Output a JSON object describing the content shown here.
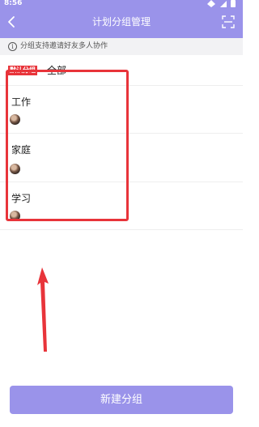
{
  "status_bar": {
    "time": "8:56",
    "icons": [
      "wifi-icon",
      "signal-icon",
      "battery-icon"
    ]
  },
  "header": {
    "title": "计划分组管理",
    "back_icon": "chevron-left-icon",
    "action_icon": "scan-icon"
  },
  "notice": {
    "icon": "info-icon",
    "icon_glyph": "i",
    "text": "分组支持邀请好友多人协作"
  },
  "list": {
    "all_row": {
      "tag": "默认分组",
      "label": "全部"
    },
    "groups": [
      {
        "name": "工作"
      },
      {
        "name": "家庭"
      },
      {
        "name": "学习"
      }
    ]
  },
  "footer": {
    "new_group_label": "新建分组"
  },
  "colors": {
    "accent": "#9a93ea",
    "tag_red": "#e8343a",
    "annotation_red": "#e8343a",
    "notice_bg": "#f2f2f4"
  }
}
